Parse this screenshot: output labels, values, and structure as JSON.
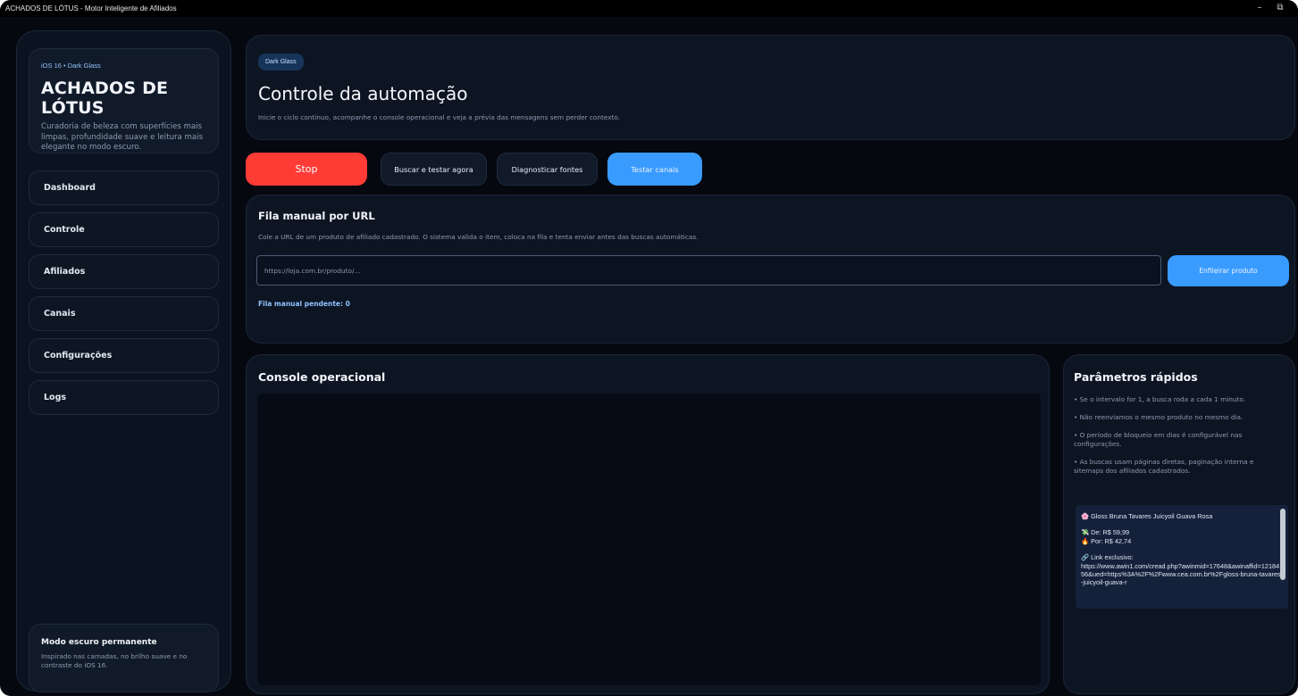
{
  "window": {
    "title": "ACHADOS DE LÓTUS - Motor Inteligente de Afiliados",
    "minimize_glyph": "–",
    "maximize_glyph": "⧉"
  },
  "sidebar": {
    "tag": "iOS 16 • Dark Glass",
    "title": "ACHADOS DE LÓTUS",
    "description": "Curadoria de beleza com superfícies mais limpas, profundidade suave e leitura mais elegante no modo escuro.",
    "nav": [
      {
        "label": "Dashboard"
      },
      {
        "label": "Controle"
      },
      {
        "label": "Afiliados"
      },
      {
        "label": "Canais"
      },
      {
        "label": "Configurações"
      },
      {
        "label": "Logs"
      }
    ],
    "footer": {
      "title": "Modo escuro permanente",
      "description": "Inspirado nas camadas, no brilho suave e no contraste do iOS 16."
    }
  },
  "header": {
    "pill": "Dark Glass",
    "title": "Controle da automação",
    "subtitle": "Inicie o ciclo contínuo, acompanhe o console operacional e veja a prévia das mensagens sem perder contexto."
  },
  "actions": {
    "stop": "Stop",
    "search_test": "Buscar e testar agora",
    "diagnose": "Diagnosticar fontes",
    "test_channels": "Testar canais"
  },
  "queue": {
    "title": "Fila manual por URL",
    "description": "Cole a URL de um produto de afiliado cadastrado. O sistema valida o item, coloca na fila e tenta enviar antes das buscas automáticas.",
    "input_placeholder": "https://loja.com.br/produto/...",
    "input_value": "",
    "enqueue_button": "Enfileirar produto",
    "pending": "Fila manual pendente: 0"
  },
  "console": {
    "title": "Console operacional"
  },
  "params": {
    "title": "Parâmetros rápidos",
    "tips": [
      "• Se o intervalo for 1, a busca roda a cada 1 minuto.",
      "• Não reenviamos o mesmo produto no mesmo dia.",
      "• O período de bloqueio em dias é configurável nas configurações.",
      "• As buscas usam páginas diretas, paginação interna e sitemaps dos afiliados cadastrados."
    ],
    "preview": {
      "product": "🌸 Gloss Bruna Tavares Juicyoil Guava Rosa",
      "price_from": "💸 De: R$ 59,99",
      "price_to": "🔥 Por: R$ 42,74",
      "link_label": "🔗 Link exclusivo:",
      "link": "https://www.awin1.com/cread.php?awinmid=17648&awinaffid=1218456&ued=https%3A%2F%2Fwww.cea.com.br%2Fgloss-bruna-tavares-juicyoil-guava-r"
    }
  },
  "colors": {
    "accent_blue": "#3a9bff",
    "stop_red": "#ff3b36",
    "background": "#05080f",
    "panel": "#0d1523"
  }
}
